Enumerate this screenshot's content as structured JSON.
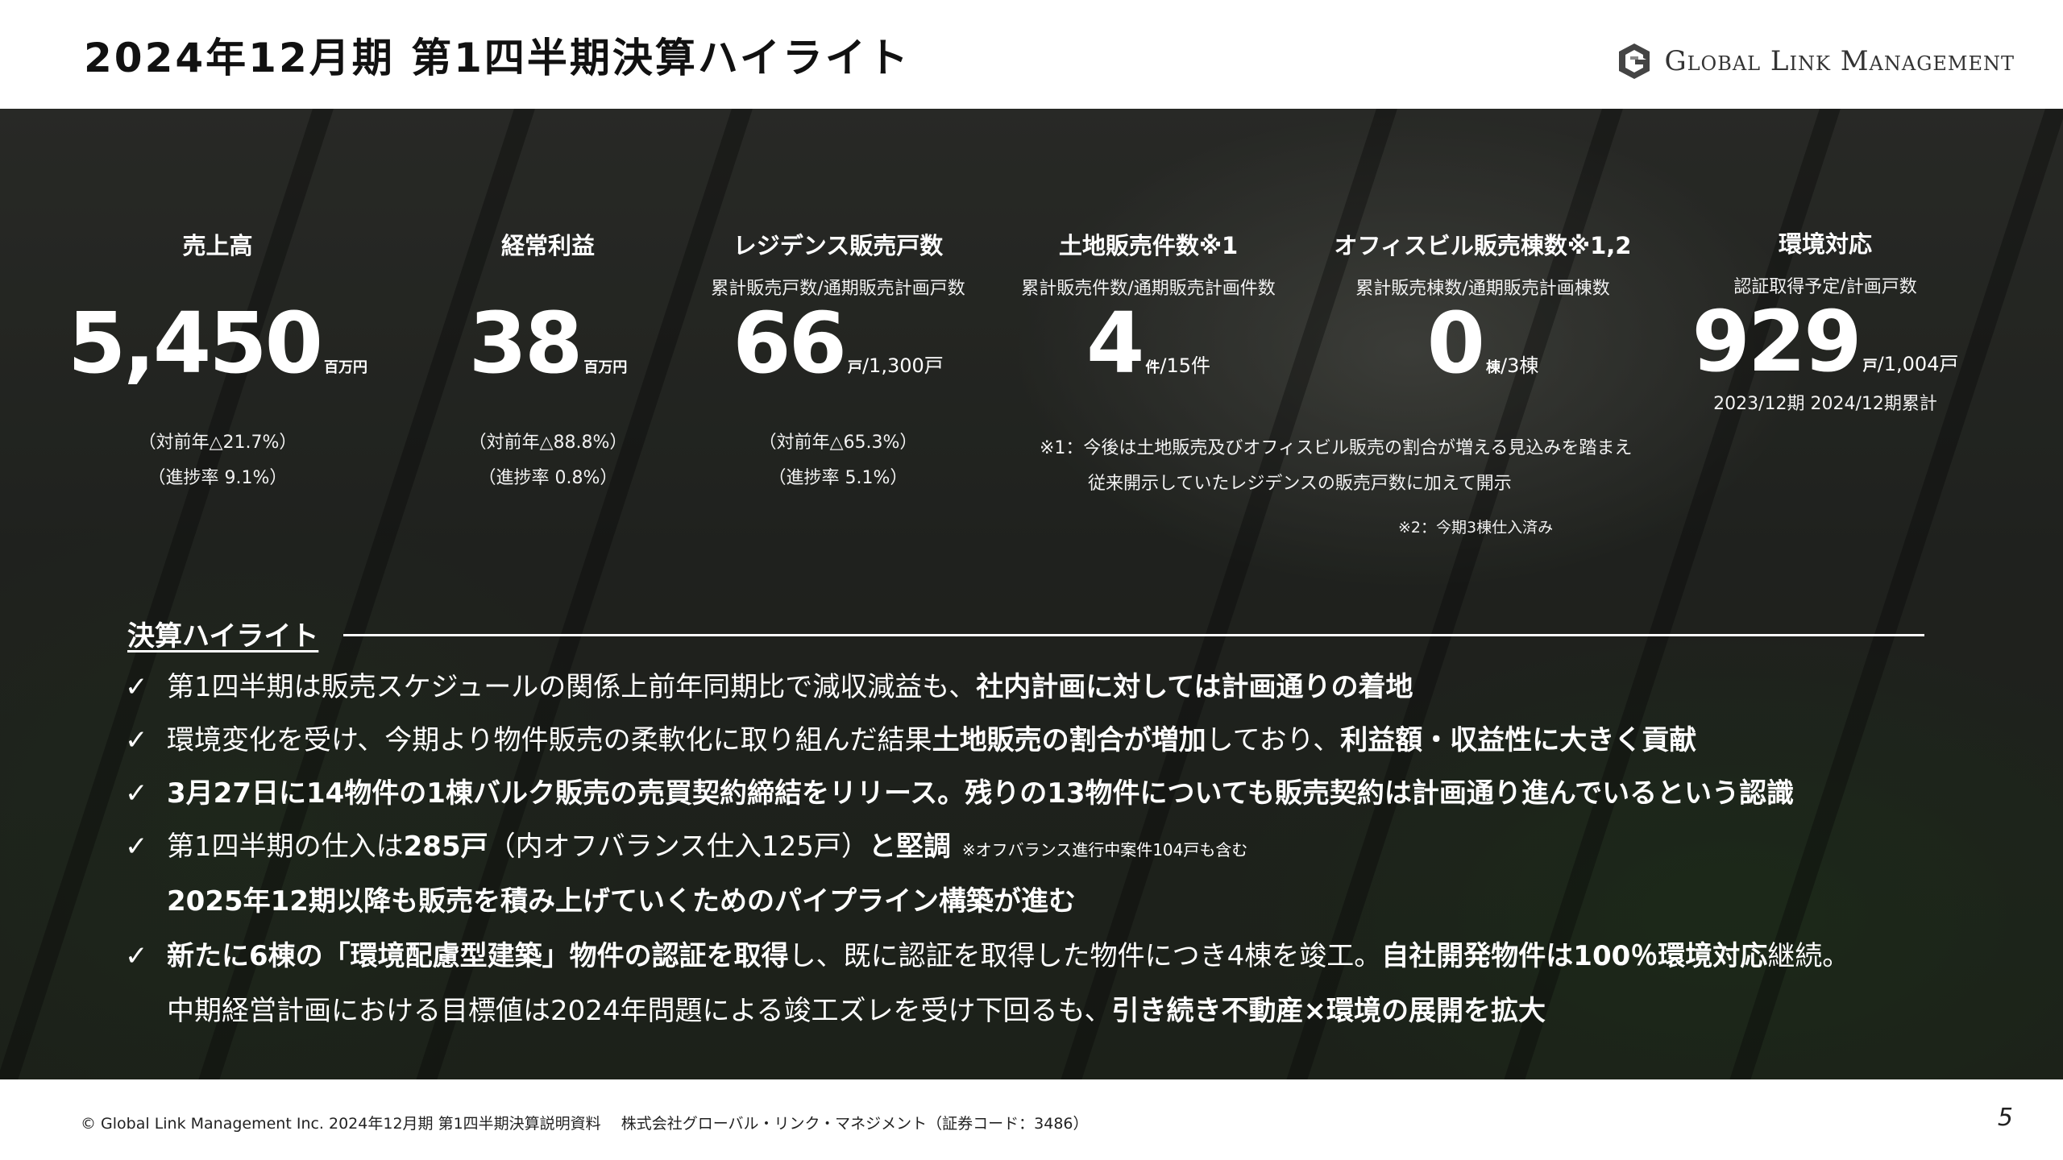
{
  "header": {
    "title": "2024年12月期 第1四半期決算ハイライト",
    "logo_text": "Global Link Management"
  },
  "kpis": [
    {
      "title": "売上高",
      "subtitle": "",
      "value": "5,450",
      "unit": "百万円",
      "fraction": "",
      "notes": [
        "（対前年△21.7%）",
        "（進捗率 9.1%）"
      ]
    },
    {
      "title": "経常利益",
      "subtitle": "",
      "value": "38",
      "unit": "百万円",
      "fraction": "",
      "notes": [
        "（対前年△88.8%）",
        "（進捗率 0.8%）"
      ]
    },
    {
      "title": "レジデンス販売戸数",
      "subtitle": "累計販売戸数/通期販売計画戸数",
      "value": "66",
      "unit": "戸",
      "fraction": "/1,300戸",
      "notes": [
        "（対前年△65.3%）",
        "（進捗率 5.1%）"
      ]
    },
    {
      "title": "土地販売件数※1",
      "subtitle": "累計販売件数/通期販売計画件数",
      "value": "4",
      "unit": "件",
      "fraction": "/15件",
      "notes": []
    },
    {
      "title": "オフィスビル販売棟数※1,2",
      "subtitle": "累計販売棟数/通期販売計画棟数",
      "value": "0",
      "unit": "棟",
      "fraction": "/3棟",
      "notes": []
    },
    {
      "title": "環境対応",
      "subtitle": "認証取得予定/計画戸数",
      "value": "929",
      "unit": "戸",
      "fraction": "/1,004戸",
      "notes": [
        "2023/12期 2024/12期累計"
      ]
    }
  ],
  "footnotes": {
    "note1_line1": "※1：今後は土地販売及びオフィスビル販売の割合が増える見込みを踏まえ",
    "note1_line2": "従来開示していたレジデンスの販売戸数に加えて開示",
    "note2": "※2：今期3棟仕入済み"
  },
  "highlights": {
    "heading": "決算ハイライト",
    "check": "✓",
    "items": [
      {
        "t1": "第1四半期は販売スケジュールの関係上前年同期比で減収減益も、",
        "b1": "社内計画に対しては計画通りの着地"
      },
      {
        "t1": "環境変化を受け、今期より物件販売の柔軟化に取り組んだ結果",
        "b1": "土地販売の割合が増加",
        "t2": "しており、",
        "b2": "利益額・収益性に大きく貢献"
      },
      {
        "b1": "3月27日に14物件の1棟バルク販売の売買契約締結をリリース。残りの13物件についても販売契約は計画通り進んでいるという認識"
      },
      {
        "t1": "第1四半期の仕入は",
        "b1": "285戸",
        "t2": "（内オフバランス仕入125戸）",
        "b2": "と堅調",
        "small": "※オフバランス進行中案件104戸も含む"
      },
      {
        "b1": "2025年12期以降も販売を積み上げていくためのパイプライン構築が進む"
      },
      {
        "b1": "新たに6棟の「環境配慮型建築」物件の認証を取得",
        "t1": "し、既に認証を取得した物件につき4棟を竣工。",
        "b2": "自社開発物件は100％環境対応",
        "t2": "継続。"
      },
      {
        "t1": "中期経営計画における目標値は2024年問題による竣工ズレを受け下回るも、",
        "b1": "引き続き不動産×環境の展開を拡大"
      }
    ]
  },
  "footer": {
    "copyright": "© Global Link Management Inc. 2024年12月期 第1四半期決算説明資料　 株式会社グローバル・リンク・マネジメント（証券コード：3486）",
    "page_number": "5"
  }
}
